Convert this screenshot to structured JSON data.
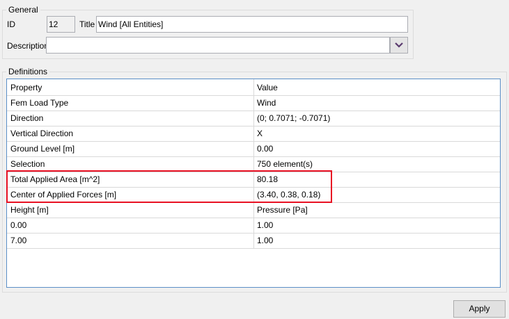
{
  "general": {
    "legend": "General",
    "id_label": "ID",
    "id_value": "12",
    "title_label": "Title",
    "title_value": "Wind [All Entities]",
    "description_label": "Description",
    "description_value": ""
  },
  "definitions": {
    "legend": "Definitions",
    "headers": [
      "Property",
      "Value"
    ],
    "rows": [
      [
        "Fem Load Type",
        "Wind"
      ],
      [
        "Direction",
        "(0; 0.7071; -0.7071)"
      ],
      [
        "Vertical Direction",
        "X"
      ],
      [
        "Ground Level [m]",
        "0.00"
      ],
      [
        "Selection",
        "750 element(s)"
      ],
      [
        "Total Applied Area [m^2]",
        "80.18"
      ],
      [
        "Center of Applied Forces [m]",
        "(3.40, 0.38, 0.18)"
      ],
      [
        "Height [m]",
        "Pressure [Pa]"
      ],
      [
        "0.00",
        "1.00"
      ],
      [
        "7.00",
        "1.00"
      ]
    ],
    "highlight_color": "#e81123"
  },
  "apply_label": "Apply"
}
